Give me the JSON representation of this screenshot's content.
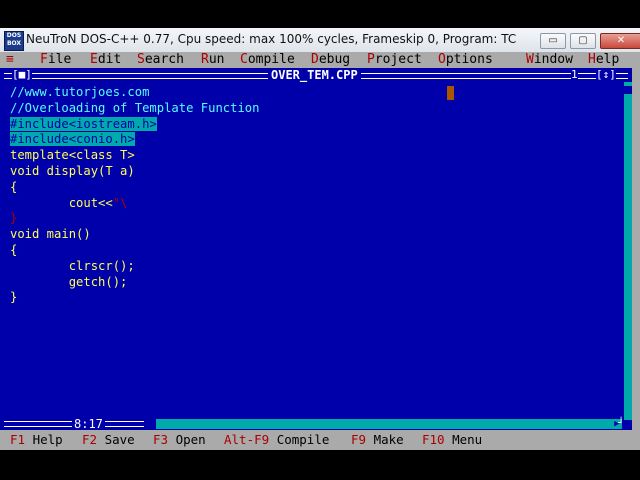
{
  "window": {
    "title": "NeuTroN DOS-C++ 0.77, Cpu speed: max 100% cycles, Frameskip  0, Program:     TC",
    "icon_text": "DOS BOX",
    "min_label": "▭",
    "max_label": "▢",
    "close_label": "✕"
  },
  "menu": {
    "system": "≡",
    "items": [
      {
        "hk": "F",
        "rest": "ile"
      },
      {
        "hk": "E",
        "rest": "dit"
      },
      {
        "hk": "S",
        "rest": "earch"
      },
      {
        "hk": "R",
        "rest": "un"
      },
      {
        "hk": "C",
        "rest": "ompile"
      },
      {
        "hk": "D",
        "rest": "ebug"
      },
      {
        "hk": "P",
        "rest": "roject"
      },
      {
        "hk": "O",
        "rest": "ptions"
      },
      {
        "hk": "W",
        "rest": "indow"
      },
      {
        "hk": "H",
        "rest": "elp"
      }
    ]
  },
  "editor": {
    "file_name": "OVER_TEM.CPP",
    "close_box": "[■]",
    "window_number": "1",
    "zoom_box": "[↕]",
    "cursor_position": "8:17",
    "lines": [
      {
        "text": "//www.tutorjoes.com",
        "kind": "comment"
      },
      {
        "text": "//Overloading of Template Function",
        "kind": "comment"
      },
      {
        "text": "#include<iostream.h>",
        "kind": "highlight"
      },
      {
        "text": "#include<conio.h>",
        "kind": "highlight"
      },
      {
        "text": "template<class T>",
        "kind": "code"
      },
      {
        "text": "void display(T a)",
        "kind": "code"
      },
      {
        "text": "{",
        "kind": "code"
      },
      {
        "text": "        cout<<",
        "kind": "code",
        "tail": "\"\\"
      },
      {
        "text": "",
        "kind": "code",
        "tail": "}"
      },
      {
        "text": "void main()",
        "kind": "code"
      },
      {
        "text": "{",
        "kind": "code"
      },
      {
        "text": "        clrscr();",
        "kind": "code"
      },
      {
        "text": "        getch();",
        "kind": "code"
      },
      {
        "text": "}",
        "kind": "code"
      }
    ]
  },
  "status": {
    "keys": [
      {
        "key": "F1",
        "label": "Help"
      },
      {
        "key": "F2",
        "label": "Save"
      },
      {
        "key": "F3",
        "label": "Open"
      },
      {
        "key": "Alt-F9",
        "label": "Compile"
      },
      {
        "key": "F9",
        "label": "Make"
      },
      {
        "key": "F10",
        "label": "Menu"
      }
    ]
  },
  "colors": {
    "editor_bg": "#0000aa",
    "code_text": "#ffff55",
    "comment_text": "#55ffff",
    "menu_bg": "#aaaaaa",
    "hotkey": "#aa0000",
    "selection_bg": "#00aaaa"
  }
}
